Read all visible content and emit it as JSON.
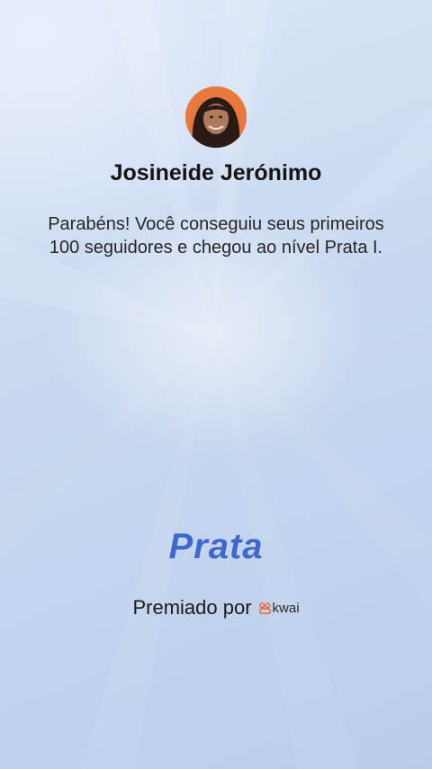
{
  "profile": {
    "avatar_icon": "user-avatar-photo",
    "name": "Josineide Jerónimo"
  },
  "message": "Parabéns! Você conseguiu seus primeiros 100 seguidores e chegou ao nível Prata I.",
  "level": {
    "label": "Prata",
    "color": "#3f68cc"
  },
  "award": {
    "label": "Premiado por",
    "brand_icon": "kwai-logo-icon",
    "brand_name": "kwai",
    "brand_color": "#ff5a1f"
  }
}
